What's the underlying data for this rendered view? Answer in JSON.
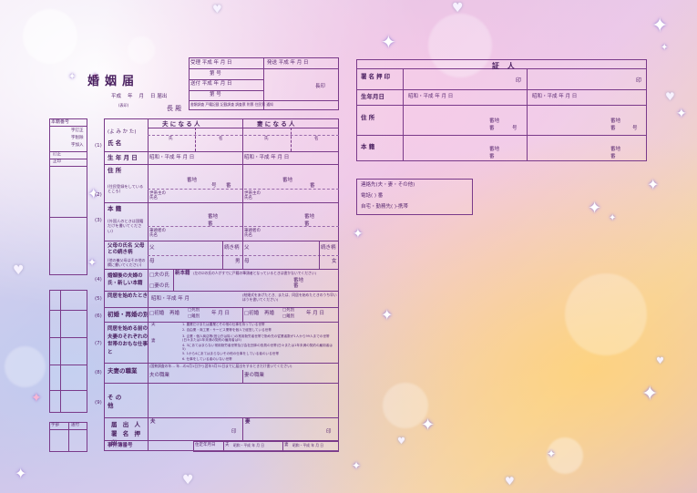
{
  "title": "婚姻届",
  "date_line": {
    "era": "平成",
    "year": "年",
    "month": "月",
    "day": "日",
    "suffix": "届出",
    "sub": "(表印)"
  },
  "office": "長 殿",
  "reception": {
    "received": "受理 平成 年 月 日",
    "number_label": "第 号",
    "sent": "送付 平成 年 月 日",
    "sent_number": "第 号",
    "sent_chief": "長印",
    "chief": "長印",
    "sent_date": "発送 平成 年 月 日",
    "checks": [
      "書類調査",
      "戸籍記載",
      "記載調査",
      "調査票",
      "附票",
      "住民票",
      "通知"
    ]
  },
  "columns": {
    "husband": "夫 に な る 人",
    "wife": "妻 に な る 人"
  },
  "rows": {
    "furigana": "(よ み か た)",
    "name": "氏 名",
    "last": "氏",
    "first": "名",
    "birth": "生 年 月 日",
    "birth_value": "昭和・平成 年 月 日",
    "address": "住 所",
    "address_note": "(住民登録をしているところ)",
    "banchi": "番地",
    "ban": "番",
    "go": "号",
    "householder": "世帯主の氏名",
    "honseki": "本 籍",
    "honseki_note": "(外国人のときは国籍だけを書いてください)",
    "head": "筆頭者の氏名",
    "parents": "父母の氏名 父母との続き柄",
    "parents_note": "(他の養父母はその他の欄に書いてください)",
    "father": "父",
    "mother": "母",
    "relation": "続き柄",
    "male": "男",
    "female": "女"
  },
  "after_marriage": {
    "label": "婚姻後の夫婦の氏・新しい本籍",
    "husband_name": "□夫の氏",
    "wife_name": "□妻の氏",
    "new_honseki": "新本籍",
    "note": "(左の☑の氏の人がすでに戸籍の筆頭者となっているときは書かないでください)",
    "banchi": "番地",
    "ban": "番"
  },
  "cohabit": {
    "label": "同居を始めたとき",
    "value": "昭和・平成 年 月",
    "note": "(結婚式をあげたとき、または、同居を始めたときのうち早いほうを書いてください)"
  },
  "remarriage": {
    "label": "初婚・再婚の別",
    "first": "□初婚",
    "again": "再婚",
    "death": "□死別",
    "divorce": "□離別",
    "value": "年 月 日"
  },
  "occupation": {
    "label": "同居を始める前の夫妻のそれぞれの世帯のおもな仕事と",
    "items": [
      "1. 農業だけまたは農業とその他の仕事を持っている世帯",
      "2. 自由業・商工業・サービス業等を個人で経営している世帯",
      "3. 企業・個人商店等(官公庁は除く)の常用勤労者世帯で勤め先の従業者数が1人から99人までの世帯(日々または1年未満の契約の雇用者は5)",
      "4. 3にあてはまらない常用勤労者世帯及び会社団体の役員の世帯(日々または1年未満の契約の雇用者は5)",
      "5. 1から4にあてはまらないその他の仕事をしている者のいる世帯",
      "6. 仕事をしている者のいない世帯"
    ],
    "husband": "夫",
    "wife": "妻"
  },
  "job": {
    "label": "夫妻の職業",
    "note": "(国勢調査の年… 年…の4月1日から翌年3月31日までに届出をするときだけ書いてください)",
    "husband": "夫の職業",
    "wife": "妻の職業"
  },
  "other": "そ の 他",
  "signature": {
    "label": "届 出 人 署 名 押 印",
    "husband": "夫",
    "wife": "妻",
    "seal": "印"
  },
  "case_number": "事件簿番号",
  "birth_date_row": {
    "label": "住定年月日",
    "husband": "夫",
    "wife": "妻",
    "value": "昭和・平成 年 月 日"
  },
  "left_panel": {
    "header": [
      "本籍番号",
      "宇訂正",
      "字削除",
      "字加入"
    ],
    "sub": [
      "訂正",
      "正印"
    ],
    "rows": [
      "(1)",
      "(2)",
      "(3)",
      "(4)",
      "(5)",
      "(6)",
      "(7)",
      "(8)",
      "(9)"
    ],
    "bottom": [
      "宇部",
      "送付"
    ]
  },
  "witness": {
    "title": "証 人",
    "rows": [
      {
        "label": "署名押印",
        "seal": "印"
      },
      {
        "label": "生年月日",
        "value": "昭和・平成 年 月 日"
      },
      {
        "label": "住 所",
        "banchi": "番地",
        "ban": "番",
        "go": "号"
      },
      {
        "label": "本 籍",
        "banchi": "番地",
        "ban": "番"
      }
    ]
  },
  "contact": {
    "title": "連絡先(夫・妻・その他)",
    "phone": "電話(  )  番",
    "home": "自宅・勤務先(  )-携帯"
  }
}
